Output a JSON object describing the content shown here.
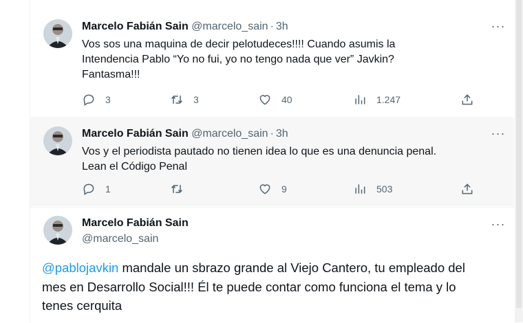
{
  "tweets": [
    {
      "name": "Marcelo Fabián Sain",
      "handle": "@marcelo_sain",
      "separator": "·",
      "time": "3h",
      "text": "Vos sos una maquina de decir pelotudeces!!!! Cuando asumis la\nIntendencia Pablo “Yo no fui, yo no tengo nada que ver” Javkin?\nFantasma!!!",
      "replies": "3",
      "retweets": "3",
      "likes": "40",
      "views": "1.247"
    },
    {
      "name": "Marcelo Fabián Sain",
      "handle": "@marcelo_sain",
      "separator": "·",
      "time": "3h",
      "text": "Vos y el periodista pautado no tienen idea lo que es una denuncia penal.\nLean el Código Penal",
      "replies": "1",
      "retweets": "",
      "likes": "9",
      "views": "503"
    },
    {
      "name": "Marcelo Fabián Sain",
      "handle": "@marcelo_sain",
      "mention": "@pablojavkin",
      "text": " mandale un sbrazo grande al Viejo Cantero, tu empleado del mes en Desarrollo Social!!! Él te puede contar como funciona el tema y lo tenes cerquita"
    }
  ],
  "more_label": "···",
  "colors": {
    "accent": "#1d9bf0",
    "muted": "#536471",
    "text": "#0f1419"
  },
  "icons": [
    "reply-icon",
    "retweet-icon",
    "like-icon",
    "views-icon",
    "share-icon",
    "more-icon",
    "avatar"
  ]
}
